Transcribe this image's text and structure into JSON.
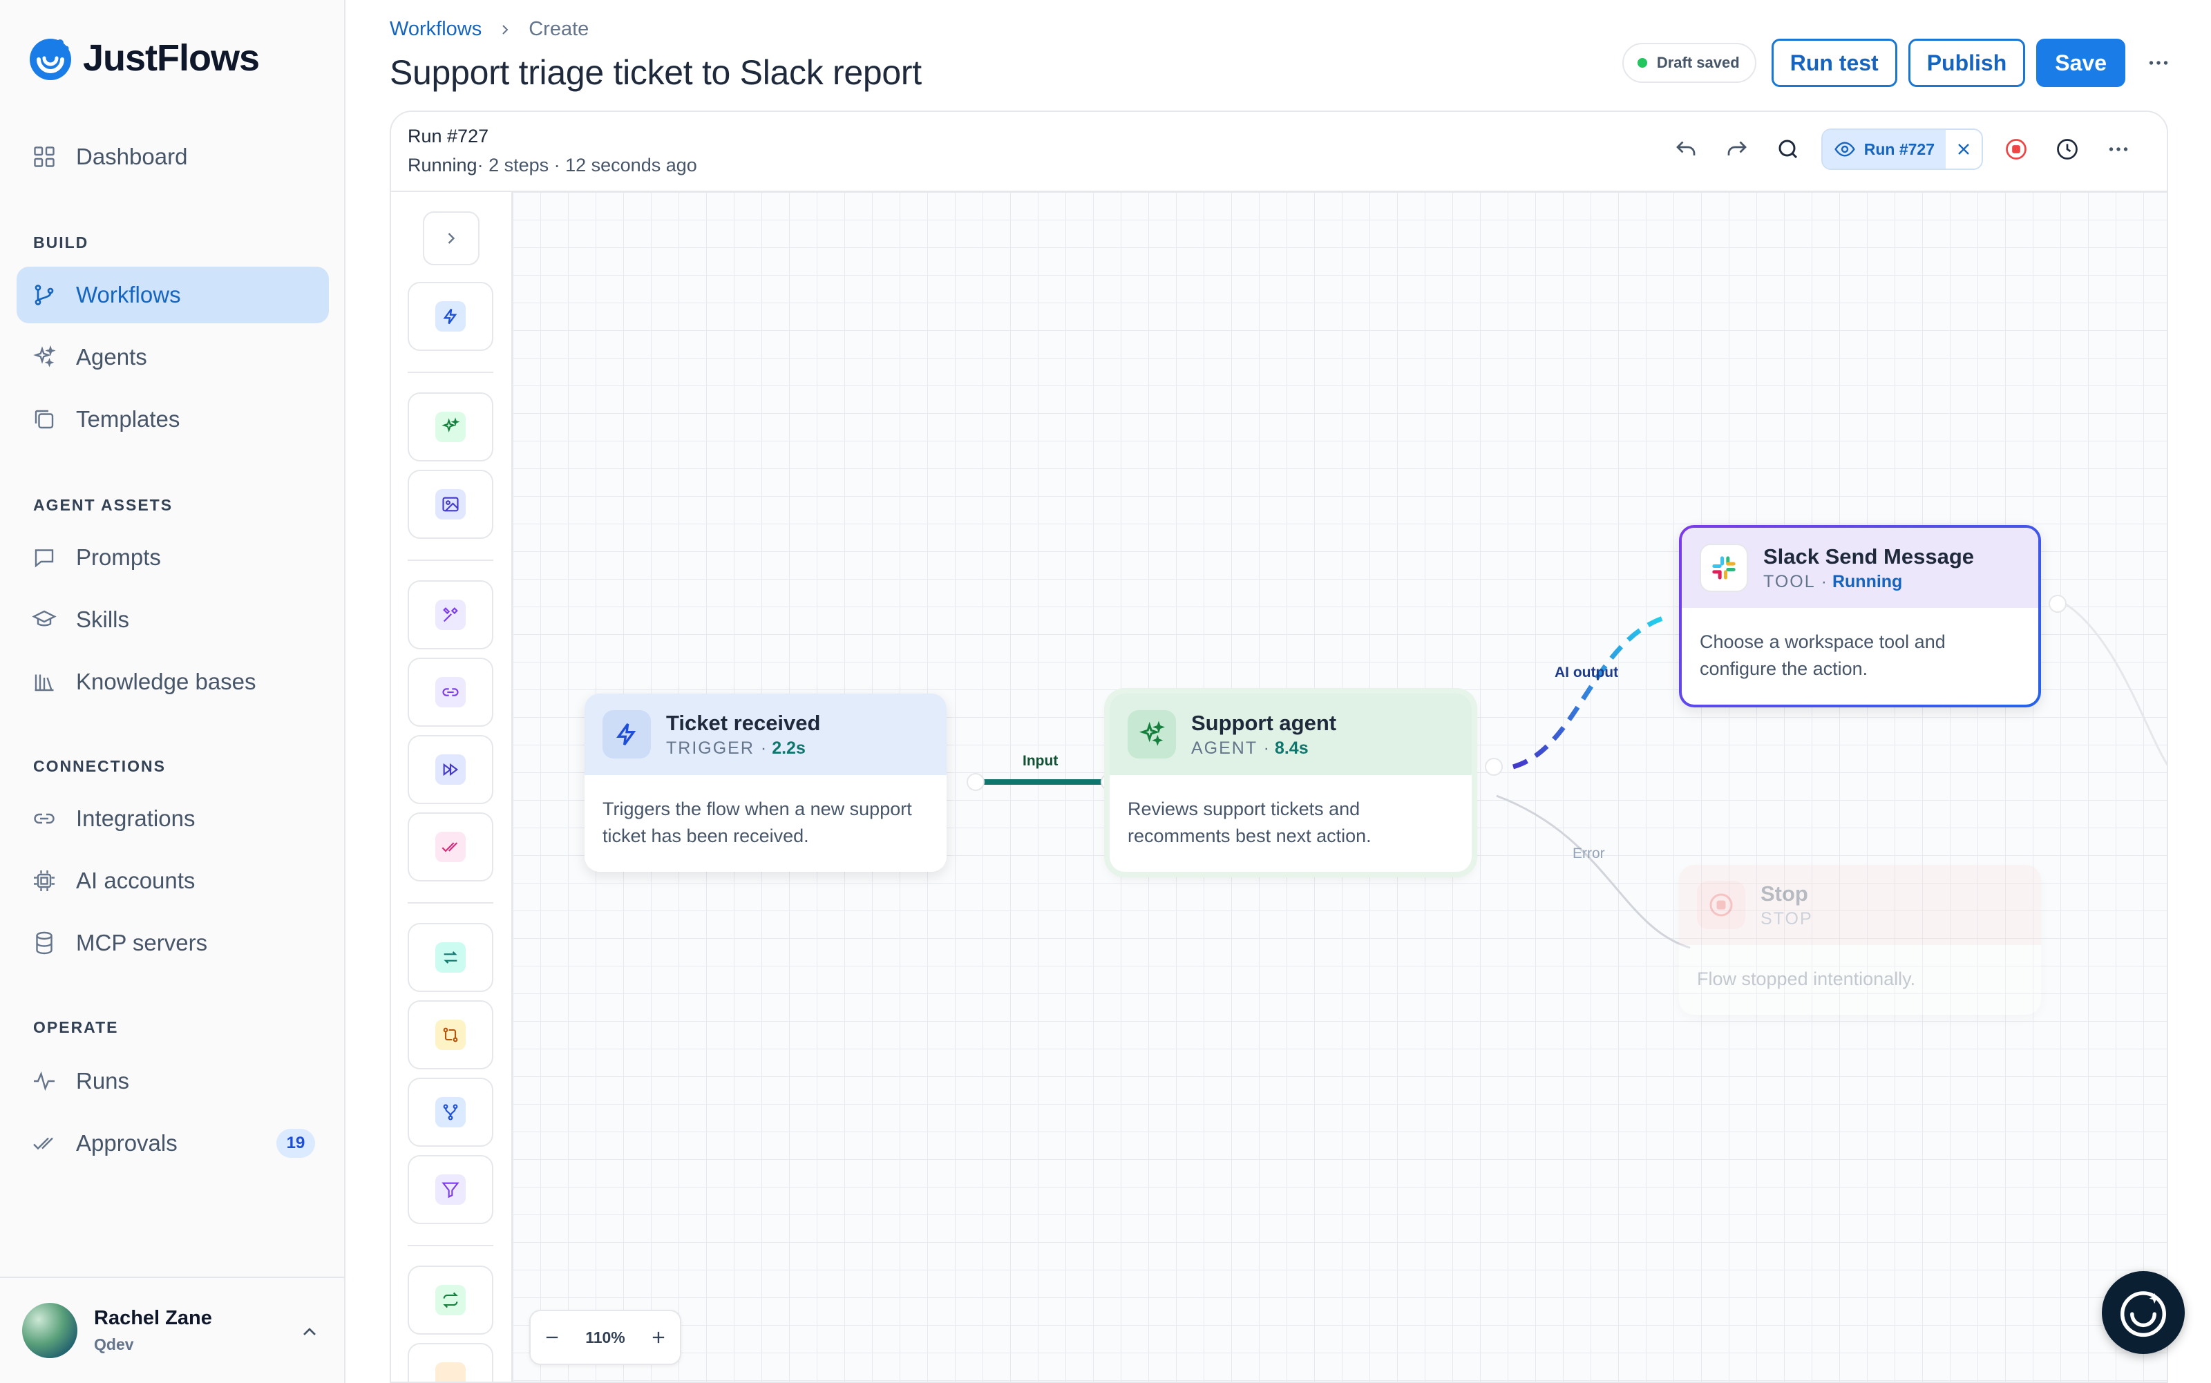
{
  "app": {
    "brand": "JustFlows"
  },
  "sidebar": {
    "dashboard": "Dashboard",
    "sections": {
      "build": "BUILD",
      "agent_assets": "AGENT ASSETS",
      "connections": "CONNECTIONS",
      "operate": "OPERATE"
    },
    "items": {
      "workflows": "Workflows",
      "agents": "Agents",
      "templates": "Templates",
      "prompts": "Prompts",
      "skills": "Skills",
      "knowledge_bases": "Knowledge bases",
      "integrations": "Integrations",
      "ai_accounts": "AI accounts",
      "mcp_servers": "MCP servers",
      "runs": "Runs",
      "approvals": "Approvals"
    },
    "approvals_badge": "19",
    "user": {
      "name": "Rachel Zane",
      "org": "Qdev"
    }
  },
  "header": {
    "breadcrumb": [
      "Workflows",
      "Create"
    ],
    "title": "Support triage ticket to Slack report",
    "draft_status": "Draft saved",
    "run_test": "Run test",
    "publish": "Publish",
    "save": "Save"
  },
  "run": {
    "id": "Run #727",
    "status": "Running",
    "details": "· 2 steps · 12 seconds ago",
    "chip": "Run #727"
  },
  "nodes": {
    "trigger": {
      "title": "Ticket received",
      "kind": "TRIGGER",
      "meta": "2.2s",
      "body": "Triggers the flow when a new support ticket has been received."
    },
    "agent": {
      "title": "Support agent",
      "kind": "AGENT",
      "meta": "8.4s",
      "body": "Reviews support tickets and recomments best next action."
    },
    "slack": {
      "title": "Slack Send Message",
      "kind": "TOOL",
      "meta": "Running",
      "body": "Choose a workspace tool and configure the action."
    },
    "stop": {
      "title": "Stop",
      "kind": "STOP",
      "body": "Flow stopped intentionally."
    }
  },
  "edges": {
    "input": "Input",
    "ai_output": "AI output",
    "error": "Error"
  },
  "zoom": {
    "level": "110%"
  },
  "colors": {
    "accent": "#1a7ce6",
    "active_nav": "#cfe3fb",
    "trigger": "#dbeafe",
    "agent": "#dcfce7",
    "tool": "#ede9fe",
    "stop": "#fee2e2",
    "running": "#1565c0"
  }
}
